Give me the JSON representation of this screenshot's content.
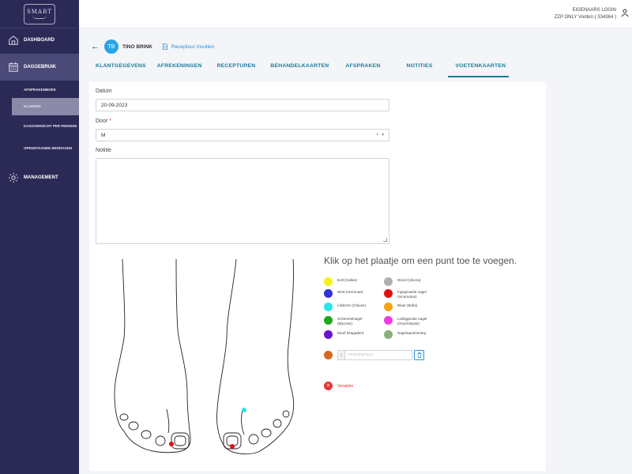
{
  "app": {
    "logo_text": "SMART"
  },
  "sidebar": {
    "dashboard": "DASHBOARD",
    "dagelijks": "DAGGEBRUIK",
    "sub_items": [
      "AFSPRAKENBOEK",
      "KLANTEN",
      "KASOVERZICHT PER PERIODE",
      "OPENSTAANDE BEDRAGEN"
    ],
    "management": "MANAGEMENT"
  },
  "header": {
    "login_label": "EIGENAARS LOGIN",
    "account": "ZZP ONLY Vorden ( 334364 )"
  },
  "client": {
    "initials": "TB",
    "name": "TINO BRINK",
    "recept_link": "Receptuur Invullen"
  },
  "tabs": [
    {
      "label": "KLANTGEGEVENS"
    },
    {
      "label": "AFREKENINGEN"
    },
    {
      "label": "RECEPTUREN"
    },
    {
      "label": "BEHANDELKAARTEN"
    },
    {
      "label": "AFSPRAKEN"
    },
    {
      "label": "NOTITIES"
    },
    {
      "label": "VOETENKAARTEN"
    }
  ],
  "form": {
    "datum_label": "Datum",
    "datum_value": "20-09-2023",
    "door_label": "Door",
    "door_required": "*",
    "door_value": "M",
    "notitie_label": "Notitie"
  },
  "foot_chart": {
    "instruction": "Klik op het plaatje om een punt toe te voegen.",
    "legend": [
      {
        "label": "Eelt (Callus)",
        "color": "#f2f21c"
      },
      {
        "label": "Wrat (Verrucae)",
        "color": "#3131e0"
      },
      {
        "label": "Likdoorn (Clavus)",
        "color": "#27e6e6"
      },
      {
        "label": "Schimmelnagel (Mycose)",
        "color": "#1fa81f"
      },
      {
        "label": "Kloof (Ragaden)",
        "color": "#6a14c8"
      },
      {
        "label": "Wond (Ulcera)",
        "color": "#b0b0b0"
      },
      {
        "label": "Ingegroeide nagel (Incarnatus)",
        "color": "#e01010"
      },
      {
        "label": "Blaar (Bulla)",
        "color": "#f2a214"
      },
      {
        "label": "Losliggende nagel (Onycholysis)",
        "color": "#f23ce0"
      },
      {
        "label": "Nagelaandoening",
        "color": "#8ab07a"
      }
    ],
    "custom_number": "1",
    "custom_placeholder": "Omschrijving in",
    "delete_label": "Verwijder"
  },
  "colors": {
    "sidebar": "#2b2a57",
    "accent": "#1b7a99",
    "link": "#2a8fd6"
  }
}
